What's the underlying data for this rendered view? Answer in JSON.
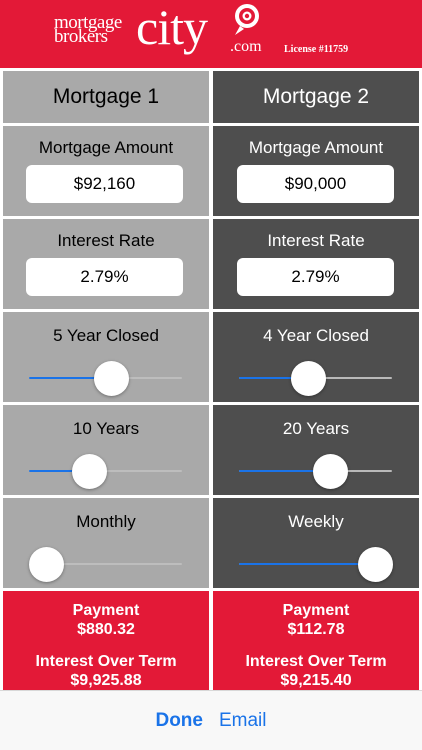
{
  "header": {
    "logo_mortgage": "mortgage",
    "logo_brokers": "brokers",
    "logo_city": "city",
    "logo_com": ".com",
    "license": "License #11759",
    "brand_color": "#e31937"
  },
  "mortgage1": {
    "title": "Mortgage 1",
    "amount_label": "Mortgage Amount",
    "amount_value": "$92,160",
    "rate_label": "Interest Rate",
    "rate_value": "2.79%",
    "term_label": "5 Year Closed",
    "term_slider_fraction": 0.55,
    "amort_label": "10 Years",
    "amort_slider_fraction": 0.36,
    "freq_label": "Monthly",
    "freq_slider_fraction": 0.0,
    "payment_label": "Payment",
    "payment_value": "$880.32",
    "interest_label": "Interest Over Term",
    "interest_value": "$9,925.88"
  },
  "mortgage2": {
    "title": "Mortgage 2",
    "amount_label": "Mortgage Amount",
    "amount_value": "$90,000",
    "rate_label": "Interest Rate",
    "rate_value": "2.79%",
    "term_label": "4 Year Closed",
    "term_slider_fraction": 0.44,
    "amort_label": "20 Years",
    "amort_slider_fraction": 0.62,
    "freq_label": "Weekly",
    "freq_slider_fraction": 1.0,
    "payment_label": "Payment",
    "payment_value": "$112.78",
    "interest_label": "Interest Over Term",
    "interest_value": "$9,215.40"
  },
  "toolbar": {
    "done_label": "Done",
    "email_label": "Email"
  }
}
